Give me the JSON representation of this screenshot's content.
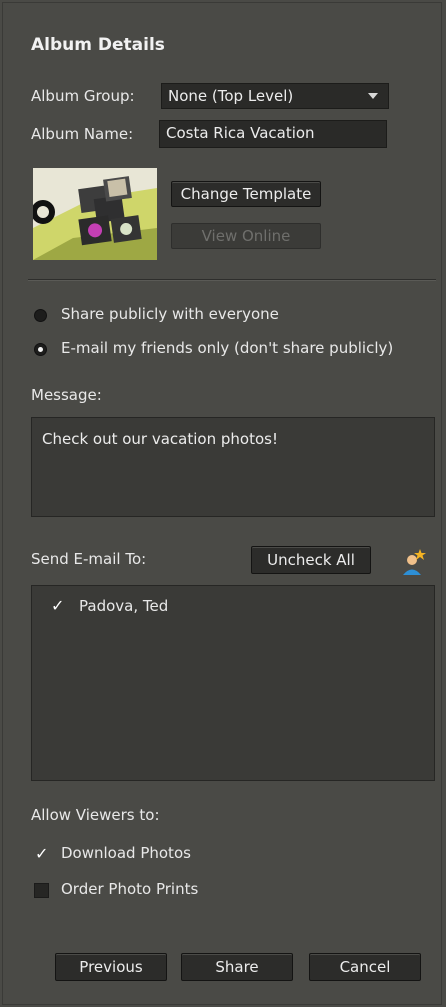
{
  "header": {
    "title": "Album Details"
  },
  "album": {
    "group_label": "Album Group:",
    "group_value": "None (Top Level)",
    "name_label": "Album Name:",
    "name_value": "Costa Rica Vacation"
  },
  "template": {
    "change_label": "Change Template",
    "view_label": "View Online"
  },
  "share_options": {
    "public_label": "Share publicly with everyone",
    "public_selected": false,
    "email_label": "E-mail my friends only (don't share publicly)",
    "email_selected": true
  },
  "message": {
    "label": "Message:",
    "value": "Check out our vacation photos!"
  },
  "send_to": {
    "label": "Send E-mail To:",
    "uncheck_all_label": "Uncheck All",
    "add_contact_icon": "add-contact-icon",
    "contacts": [
      {
        "name": "Padova, Ted",
        "checked": true
      }
    ]
  },
  "viewers": {
    "label": "Allow Viewers to:",
    "download_label": "Download Photos",
    "download_checked": true,
    "prints_label": "Order Photo Prints",
    "prints_checked": false
  },
  "footer": {
    "previous_label": "Previous",
    "share_label": "Share",
    "cancel_label": "Cancel"
  },
  "colors": {
    "panel_bg": "#4a4a46",
    "field_bg": "#2a2a28",
    "text": "#e6e6e6",
    "disabled_text": "#6f6f6c"
  }
}
